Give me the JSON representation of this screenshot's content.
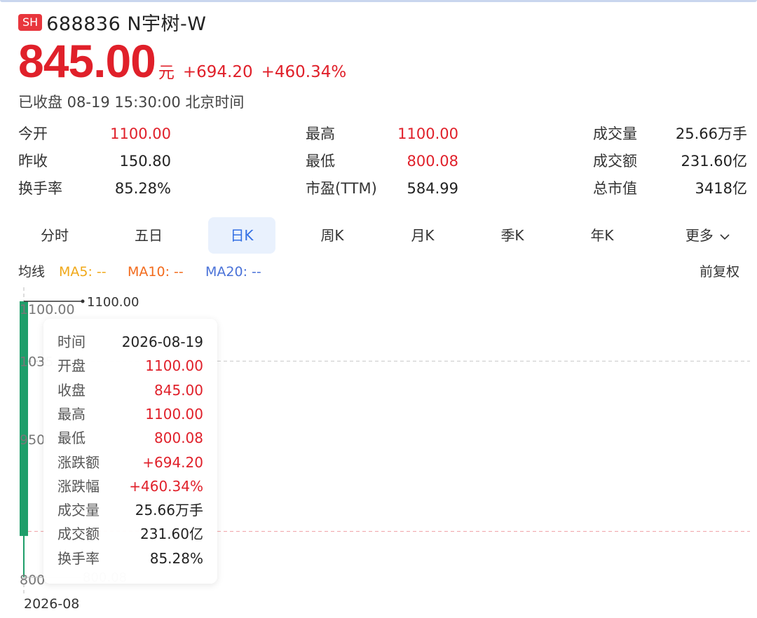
{
  "header": {
    "market_badge": "SH",
    "code_name": "688836 N宇树-W"
  },
  "quote": {
    "price": "845.00",
    "unit": "元",
    "change": "+694.20",
    "change_pct": "+460.34%",
    "status": "已收盘 08-19 15:30:00 北京时间"
  },
  "stats": [
    {
      "label": "今开",
      "value": "1100.00",
      "tone": "red"
    },
    {
      "label": "最高",
      "value": "1100.00",
      "tone": "red"
    },
    {
      "label": "成交量",
      "value": "25.66万手",
      "tone": "dark"
    },
    {
      "label": "昨收",
      "value": "150.80",
      "tone": "dark"
    },
    {
      "label": "最低",
      "value": "800.08",
      "tone": "red"
    },
    {
      "label": "成交额",
      "value": "231.60亿",
      "tone": "dark"
    },
    {
      "label": "换手率",
      "value": "85.28%",
      "tone": "dark"
    },
    {
      "label": "市盈(TTM)",
      "value": "584.99",
      "tone": "dark"
    },
    {
      "label": "总市值",
      "value": "3418亿",
      "tone": "dark"
    }
  ],
  "tabs": [
    "分时",
    "五日",
    "日K",
    "周K",
    "月K",
    "季K",
    "年K",
    "更多"
  ],
  "active_tab": "日K",
  "ma_bar": {
    "label": "均线",
    "ma5": "MA5: --",
    "ma10": "MA10: --",
    "ma20": "MA20: --",
    "adjust": "前复权",
    "colors": {
      "ma5": "#f0a818",
      "ma10": "#f26b1d",
      "ma20": "#4a72d8"
    }
  },
  "chart_data": {
    "type": "candlestick",
    "x_label": "2026-08",
    "y_labels": [
      "1100.00",
      "1035",
      "950",
      "800"
    ],
    "high_label": "1100.00",
    "low_label": "800.08",
    "ylim": [
      800,
      1100
    ],
    "candles": [
      {
        "date": "2026-08-19",
        "open": 1100.0,
        "close": 845.0,
        "high": 1100.0,
        "low": 800.08
      }
    ],
    "ref_lines": [
      1035,
      850
    ],
    "colors": {
      "down": "#1e9e6a",
      "up": "#e0202a"
    }
  },
  "tooltip": [
    {
      "label": "时间",
      "value": "2026-08-19",
      "tone": "dark"
    },
    {
      "label": "开盘",
      "value": "1100.00",
      "tone": "red"
    },
    {
      "label": "收盘",
      "value": "845.00",
      "tone": "red"
    },
    {
      "label": "最高",
      "value": "1100.00",
      "tone": "red"
    },
    {
      "label": "最低",
      "value": "800.08",
      "tone": "red"
    },
    {
      "label": "涨跌额",
      "value": "+694.20",
      "tone": "red"
    },
    {
      "label": "涨跌幅",
      "value": "+460.34%",
      "tone": "red"
    },
    {
      "label": "成交量",
      "value": "25.66万手",
      "tone": "dark"
    },
    {
      "label": "成交额",
      "value": "231.60亿",
      "tone": "dark"
    },
    {
      "label": "换手率",
      "value": "85.28%",
      "tone": "dark"
    }
  ]
}
